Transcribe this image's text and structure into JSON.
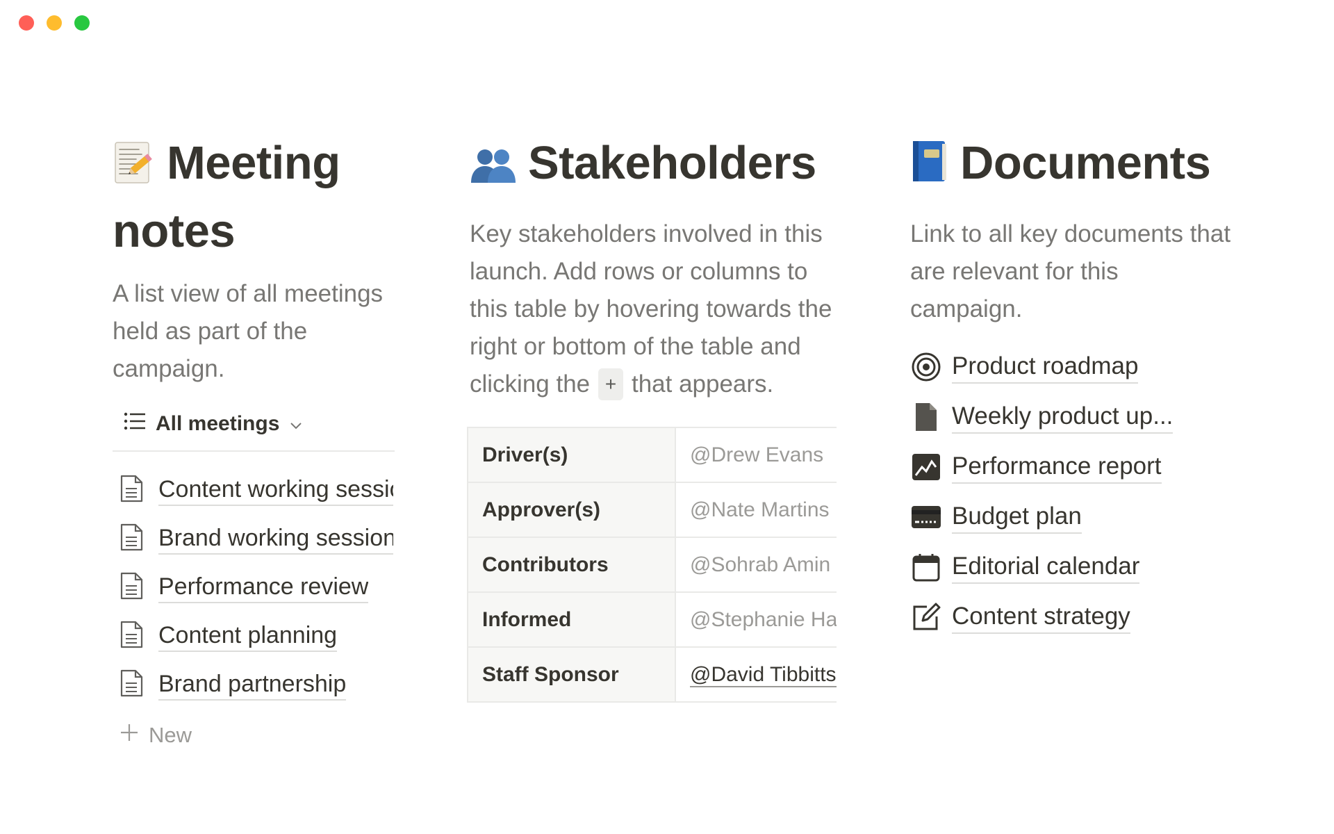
{
  "window": {
    "controls": [
      "close",
      "minimize",
      "zoom"
    ],
    "colors": {
      "close": "#ff5f57",
      "minimize": "#febc2e",
      "zoom": "#28c840"
    }
  },
  "meeting_notes": {
    "icon": "memo-pencil-icon",
    "title_line1": "Meeting",
    "title_line2": "notes",
    "description": "A list of all meetings held as part of the campaign.",
    "desc_lines": [
      "A list view of all meetings",
      "held as part of the",
      "campaign."
    ],
    "view_label": "All meetings",
    "items": [
      {
        "label": "Content working session",
        "icon": "document-icon"
      },
      {
        "label": "Brand working session",
        "icon": "document-icon"
      },
      {
        "label": "Performance review",
        "icon": "document-icon"
      },
      {
        "label": "Content planning",
        "icon": "document-icon"
      },
      {
        "label": "Brand partnership",
        "icon": "document-icon"
      }
    ],
    "new_label": "New"
  },
  "stakeholders": {
    "icon": "busts-in-silhouette-icon",
    "title": "Stakeholders",
    "desc_lines": [
      "Key stakeholders involved in this",
      "launch. Add rows or columns to",
      "this table by hovering towards the",
      "right or bottom of the table and"
    ],
    "desc_last_before": "clicking the",
    "desc_plus": "+",
    "desc_last_after": "that appears.",
    "rows": [
      {
        "key": "Driver(s)",
        "value": "@Drew Evans"
      },
      {
        "key": "Approver(s)",
        "value": "@Nate Martins"
      },
      {
        "key": "Contributors",
        "value": "@Sohrab Amin"
      },
      {
        "key": "Informed",
        "value": "@Stephanie Ha"
      },
      {
        "key": "Staff Sponsor",
        "value": "@David Tibbitts"
      }
    ]
  },
  "documents": {
    "icon": "blue-book-icon",
    "title": "Documents",
    "desc_lines": [
      "Link to all key documents that",
      "are relevant for this",
      "campaign."
    ],
    "items": [
      {
        "label": "Product roadmap",
        "icon": "target-icon"
      },
      {
        "label": "Weekly product up...",
        "icon": "file-icon"
      },
      {
        "label": "Performance report",
        "icon": "chart-icon"
      },
      {
        "label": "Budget plan",
        "icon": "card-icon"
      },
      {
        "label": "Editorial calendar",
        "icon": "calendar-icon"
      },
      {
        "label": "Content strategy",
        "icon": "edit-icon"
      }
    ]
  }
}
